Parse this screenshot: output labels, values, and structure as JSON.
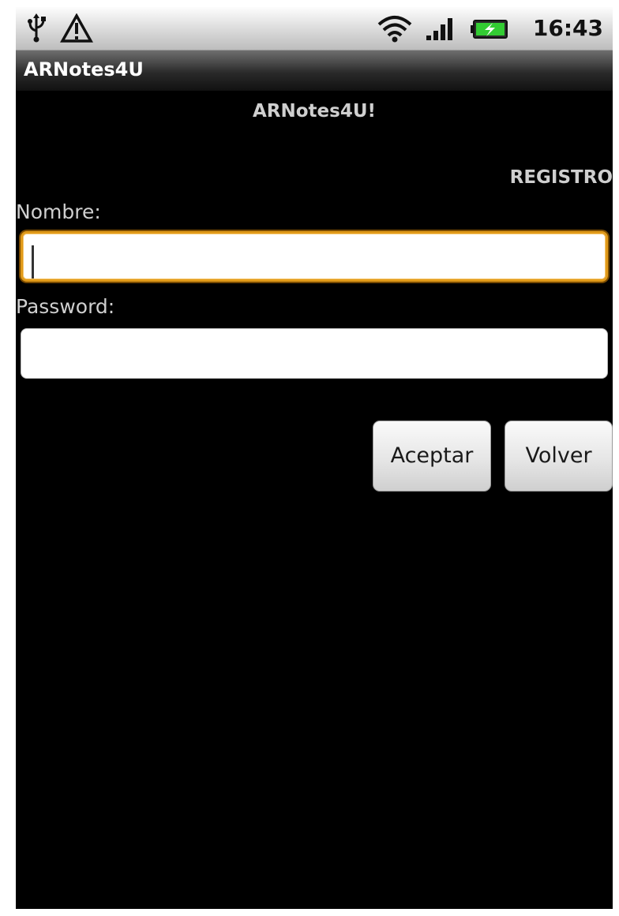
{
  "status_bar": {
    "time": "16:43",
    "icons": [
      "usb-icon",
      "warning-icon",
      "wifi-icon",
      "signal-icon",
      "battery-charging-icon"
    ]
  },
  "app": {
    "title": "ARNotes4U"
  },
  "main": {
    "heading": "ARNotes4U!",
    "section": "REGISTRO",
    "name_label": "Nombre:",
    "name_value": "",
    "password_label": "Password:",
    "password_value": "",
    "accept_label": "Aceptar",
    "back_label": "Volver"
  },
  "colors": {
    "background": "#000000",
    "text": "#cfcfcf",
    "focus_border": "#e09a1a",
    "button_bg": "#e6e6e6"
  }
}
